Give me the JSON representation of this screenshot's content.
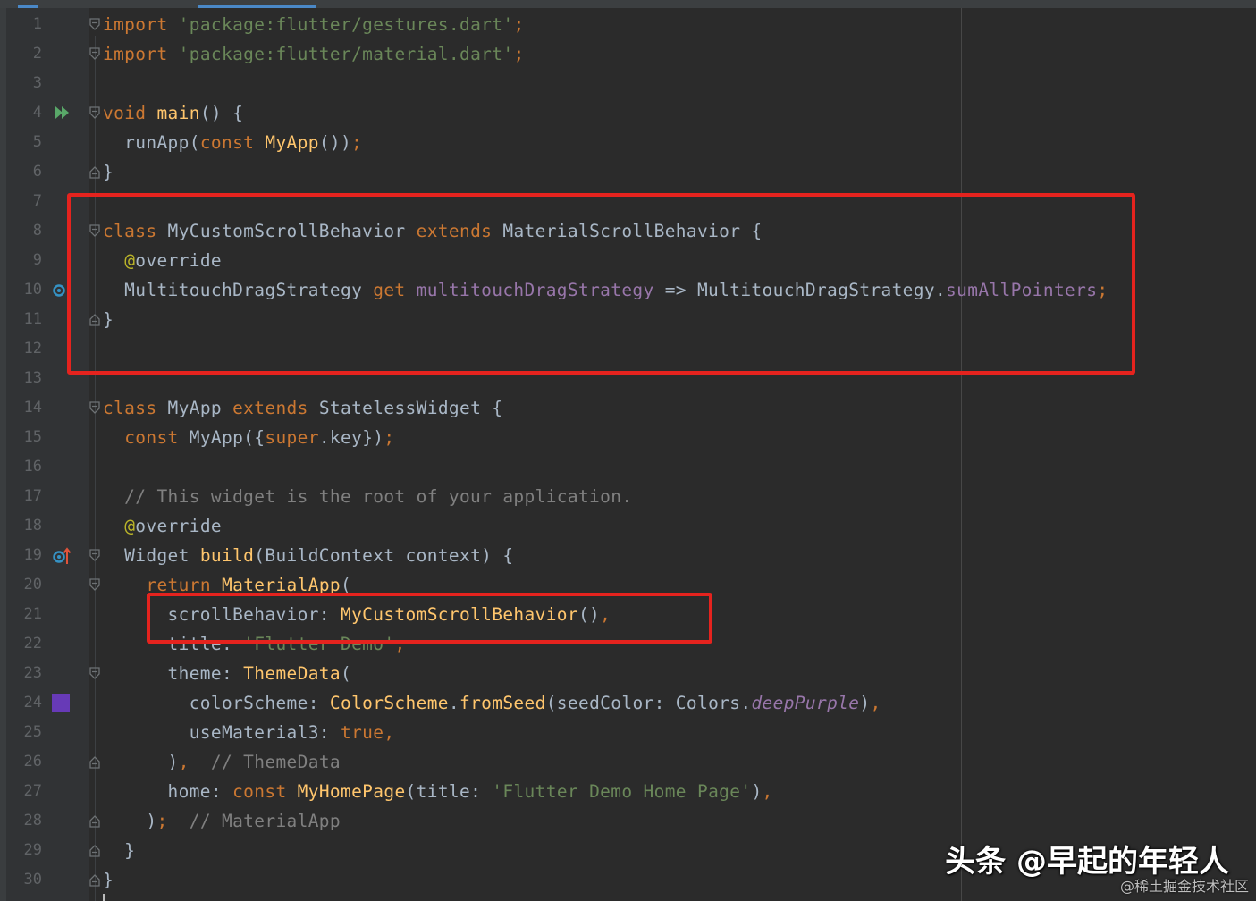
{
  "editor": {
    "language": "dart",
    "lines": [
      {
        "n": "1",
        "tokens": [
          [
            "kw",
            "import"
          ],
          [
            "txt",
            " "
          ],
          [
            "str",
            "'package:flutter/gestures.dart'"
          ],
          [
            "kw",
            ";"
          ]
        ]
      },
      {
        "n": "2",
        "tokens": [
          [
            "kw",
            "import"
          ],
          [
            "txt",
            " "
          ],
          [
            "str",
            "'package:flutter/material.dart'"
          ],
          [
            "kw",
            ";"
          ]
        ]
      },
      {
        "n": "3",
        "tokens": []
      },
      {
        "n": "4",
        "tokens": [
          [
            "kw",
            "void"
          ],
          [
            "txt",
            " "
          ],
          [
            "fn",
            "main"
          ],
          [
            "txt",
            "() {"
          ]
        ]
      },
      {
        "n": "5",
        "tokens": [
          [
            "txt",
            "  runApp("
          ],
          [
            "kw",
            "const"
          ],
          [
            "txt",
            " "
          ],
          [
            "fn",
            "MyApp"
          ],
          [
            "txt",
            "())"
          ],
          [
            "kw",
            ";"
          ]
        ]
      },
      {
        "n": "6",
        "tokens": [
          [
            "txt",
            "}"
          ]
        ]
      },
      {
        "n": "7",
        "tokens": []
      },
      {
        "n": "8",
        "tokens": [
          [
            "kw",
            "class"
          ],
          [
            "txt",
            " MyCustomScrollBehavior "
          ],
          [
            "kw",
            "extends"
          ],
          [
            "txt",
            " MaterialScrollBehavior {"
          ]
        ]
      },
      {
        "n": "9",
        "tokens": [
          [
            "txt",
            "  "
          ],
          [
            "ann",
            "@"
          ],
          [
            "txt",
            "override"
          ]
        ]
      },
      {
        "n": "10",
        "tokens": [
          [
            "txt",
            "  MultitouchDragStrategy "
          ],
          [
            "kw",
            "get"
          ],
          [
            "txt",
            " "
          ],
          [
            "fld",
            "multitouchDragStrategy"
          ],
          [
            "txt",
            " => MultitouchDragStrategy."
          ],
          [
            "fld",
            "sumAllPointers"
          ],
          [
            "kw",
            ";"
          ]
        ]
      },
      {
        "n": "11",
        "tokens": [
          [
            "txt",
            "}"
          ]
        ]
      },
      {
        "n": "12",
        "tokens": []
      },
      {
        "n": "13",
        "tokens": []
      },
      {
        "n": "14",
        "tokens": [
          [
            "kw",
            "class"
          ],
          [
            "txt",
            " MyApp "
          ],
          [
            "kw",
            "extends"
          ],
          [
            "txt",
            " StatelessWidget {"
          ]
        ]
      },
      {
        "n": "15",
        "tokens": [
          [
            "txt",
            "  "
          ],
          [
            "kw",
            "const"
          ],
          [
            "txt",
            " MyApp({"
          ],
          [
            "kw",
            "super"
          ],
          [
            "txt",
            ".key})"
          ],
          [
            "kw",
            ";"
          ]
        ]
      },
      {
        "n": "16",
        "tokens": []
      },
      {
        "n": "17",
        "tokens": [
          [
            "cmt",
            "  // This widget is the root of your application."
          ]
        ]
      },
      {
        "n": "18",
        "tokens": [
          [
            "txt",
            "  "
          ],
          [
            "ann",
            "@"
          ],
          [
            "txt",
            "override"
          ]
        ]
      },
      {
        "n": "19",
        "tokens": [
          [
            "txt",
            "  Widget "
          ],
          [
            "fn",
            "build"
          ],
          [
            "txt",
            "(BuildContext context) {"
          ]
        ]
      },
      {
        "n": "20",
        "tokens": [
          [
            "txt",
            "    "
          ],
          [
            "kw",
            "return"
          ],
          [
            "txt",
            " "
          ],
          [
            "fn",
            "MaterialApp"
          ],
          [
            "txt",
            "("
          ]
        ]
      },
      {
        "n": "21",
        "tokens": [
          [
            "txt",
            "      scrollBehavior: "
          ],
          [
            "fn",
            "MyCustomScrollBehavior"
          ],
          [
            "txt",
            "()"
          ],
          [
            "kw",
            ","
          ]
        ]
      },
      {
        "n": "22",
        "tokens": [
          [
            "txt",
            "      title: "
          ],
          [
            "str",
            "'Flutter Demo'"
          ],
          [
            "kw",
            ","
          ]
        ]
      },
      {
        "n": "23",
        "tokens": [
          [
            "txt",
            "      theme: "
          ],
          [
            "fn",
            "ThemeData"
          ],
          [
            "txt",
            "("
          ]
        ]
      },
      {
        "n": "24",
        "tokens": [
          [
            "txt",
            "        colorScheme: "
          ],
          [
            "fn",
            "ColorScheme"
          ],
          [
            "txt",
            "."
          ],
          [
            "fn",
            "fromSeed"
          ],
          [
            "txt",
            "(seedColor: Colors."
          ],
          [
            "ital",
            "deepPurple"
          ],
          [
            "txt",
            ")"
          ],
          [
            "kw",
            ","
          ]
        ]
      },
      {
        "n": "25",
        "tokens": [
          [
            "txt",
            "        useMaterial3: "
          ],
          [
            "kw",
            "true"
          ],
          [
            "kw",
            ","
          ]
        ]
      },
      {
        "n": "26",
        "tokens": [
          [
            "txt",
            "      )"
          ],
          [
            "kw",
            ","
          ],
          [
            "cmt",
            "  // ThemeData"
          ]
        ]
      },
      {
        "n": "27",
        "tokens": [
          [
            "txt",
            "      home: "
          ],
          [
            "kw",
            "const"
          ],
          [
            "txt",
            " "
          ],
          [
            "fn",
            "MyHomePage"
          ],
          [
            "txt",
            "(title: "
          ],
          [
            "str",
            "'Flutter Demo Home Page'"
          ],
          [
            "txt",
            ")"
          ],
          [
            "kw",
            ","
          ]
        ]
      },
      {
        "n": "28",
        "tokens": [
          [
            "txt",
            "    )"
          ],
          [
            "kw",
            ";"
          ],
          [
            "cmt",
            "  // MaterialApp"
          ]
        ]
      },
      {
        "n": "29",
        "tokens": [
          [
            "txt",
            "  }"
          ]
        ]
      },
      {
        "n": "30",
        "tokens": [
          [
            "txt",
            "}"
          ]
        ]
      }
    ]
  },
  "gutter_icons": {
    "run_main_line": "4",
    "override_lines": [
      "10",
      "19"
    ],
    "color_swatch_line": "24",
    "color_swatch_value": "#673ab7"
  },
  "colors": {
    "background": "#2b2b2b",
    "gutter": "#313335",
    "keyword": "#cc7832",
    "string": "#6a8759",
    "function": "#ffc66d",
    "highlight_box": "#e5231e"
  },
  "watermark": {
    "main": "头条 @早起的年轻人",
    "sub": "@稀土掘金技术社区"
  }
}
